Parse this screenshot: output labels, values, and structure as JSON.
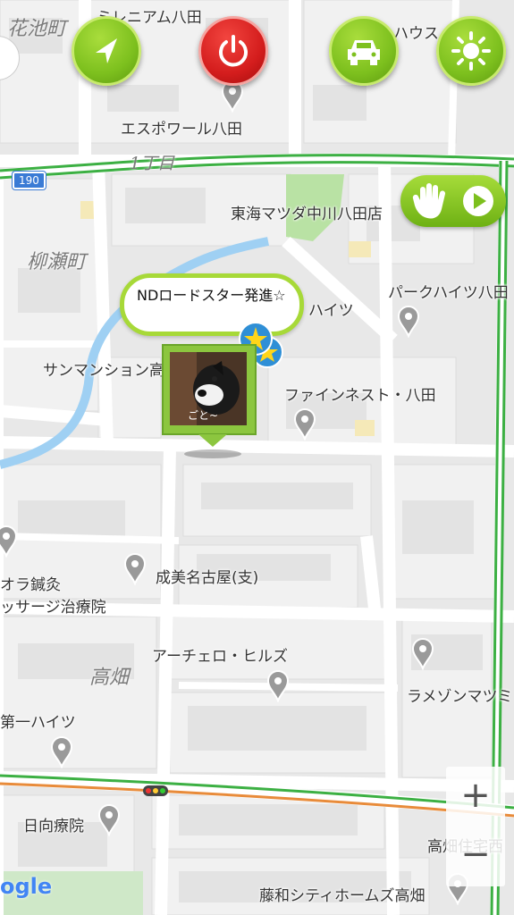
{
  "map": {
    "route_number": "190",
    "areas": [
      "花池町",
      "柳瀬町",
      "高畑"
    ],
    "chome": "1丁目",
    "places": [
      "ミレニアム八田",
      "ハウス",
      "エスポワール八田",
      "東海マツダ中川八田店",
      "パークハイツ八田",
      "ハイツ",
      "サンマンション高",
      "ファインネスト・八田",
      "成美名古屋(支)",
      "オラ鍼灸",
      "ッサージ治療院",
      "アーチェロ・ヒルズ",
      "ラメゾンマツミ",
      "第一ハイツ",
      "日向療院",
      "高畑住宅西",
      "藤和シティホームズ高畑"
    ],
    "google_logo": "ogle"
  },
  "colors": {
    "accent_green": "#7dc01e",
    "power_red": "#d41d1d",
    "highway_green": "#3cb043",
    "road_orange": "#e88b3a",
    "star_blue": "#2f8fd6",
    "star_yellow": "#ffd51a"
  },
  "toolbar": {
    "buttons": [
      {
        "icon": "navigation-arrow-icon"
      },
      {
        "icon": "power-icon"
      },
      {
        "icon": "car-icon"
      },
      {
        "icon": "sun-icon"
      }
    ]
  },
  "controls": {
    "hand_icon": "hand-icon",
    "play_icon": "play-icon",
    "zoom_in": "+",
    "zoom_out": "−"
  },
  "user": {
    "status_message": "NDロードスター発進☆",
    "avatar_label": "ごと~"
  }
}
